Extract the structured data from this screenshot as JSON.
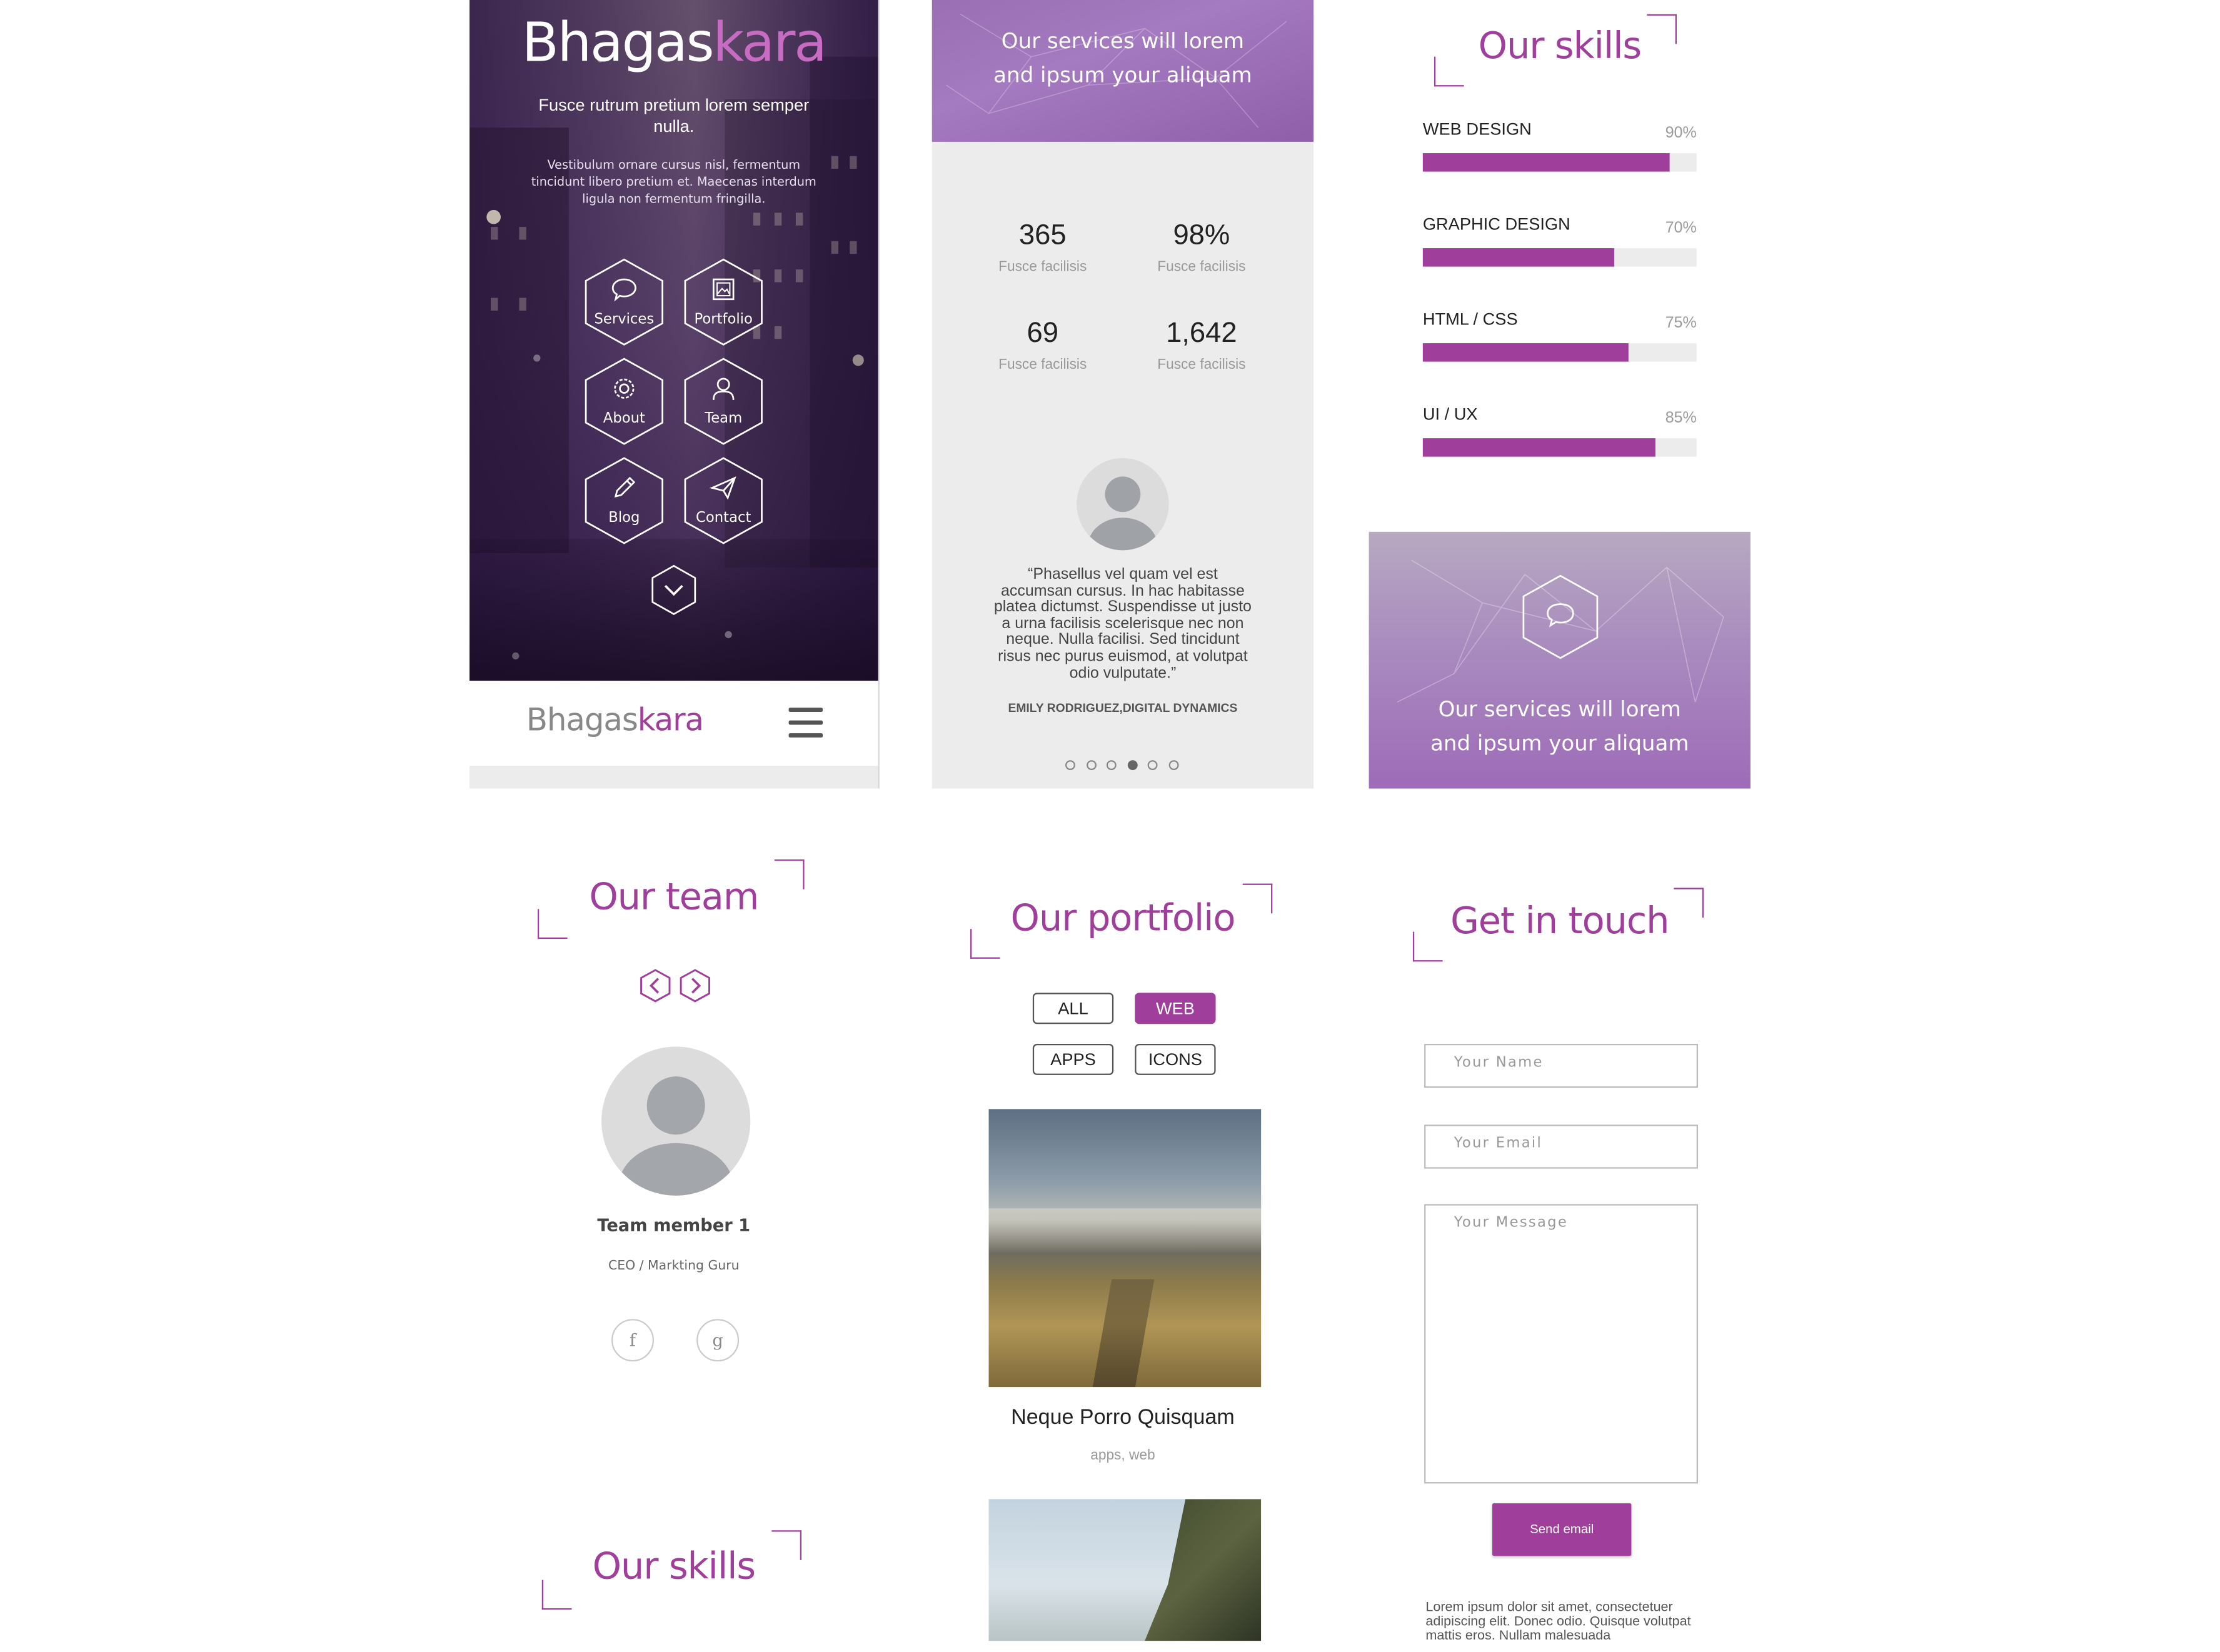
{
  "colors": {
    "accent": "#a03f9b",
    "dark_bg": "#3a2a4a",
    "light_bg": "#ececec"
  },
  "hero": {
    "brand_part1": "Bhagas",
    "brand_part2": "kara",
    "tagline": "Fusce rutrum pretium lorem semper nulla.",
    "description": "Vestibulum ornare cursus nisl, fermentum tincidunt libero pretium et. Maecenas interdum ligula non fermentum fringilla.",
    "menu": [
      {
        "label": "Services",
        "icon": "speech-bubble-icon"
      },
      {
        "label": "Portfolio",
        "icon": "image-icon"
      },
      {
        "label": "About",
        "icon": "gear-icon"
      },
      {
        "label": "Team",
        "icon": "person-icon"
      },
      {
        "label": "Blog",
        "icon": "pencil-icon"
      },
      {
        "label": "Contact",
        "icon": "paper-plane-icon"
      }
    ],
    "scroll_icon": "chevron-down-icon"
  },
  "navbar": {
    "brand_part1": "Bhagas",
    "brand_part2": "kara",
    "menu_icon": "hamburger-icon"
  },
  "services_header": {
    "line1": "Our services will lorem",
    "line2": "and ipsum your aliquam"
  },
  "stats": [
    {
      "value": "365",
      "label": "Fusce facilisis"
    },
    {
      "value": "98%",
      "label": "Fusce facilisis"
    },
    {
      "value": "69",
      "label": "Fusce facilisis"
    },
    {
      "value": "1,642",
      "label": "Fusce facilisis"
    }
  ],
  "testimonial": {
    "quote": "“Phasellus vel quam vel est accumsan cursus. In hac habitasse platea dictumst. Suspendisse ut justo a urna facilisis scelerisque nec non neque. Nulla facilisi. Sed tincidunt risus nec purus euismod, at volutpat odio vulputate.”",
    "author": "EMILY RODRIGUEZ,DIGITAL DYNAMICS",
    "active_dot": 3,
    "dot_count": 6
  },
  "skills_top": {
    "heading": "Our skills",
    "items": [
      {
        "name": "WEB DESIGN",
        "percent_label": "90%",
        "fill": 0.9
      },
      {
        "name": "GRAPHIC DESIGN",
        "percent_label": "70%",
        "fill": 0.7
      },
      {
        "name": "HTML / CSS",
        "percent_label": "75%",
        "fill": 0.75
      },
      {
        "name": "UI / UX",
        "percent_label": "85%",
        "fill": 0.85
      }
    ]
  },
  "services_box": {
    "line1": "Our services will lorem",
    "line2": "and ipsum your aliquam",
    "icon": "speech-bubble-icon"
  },
  "team": {
    "heading": "Our team",
    "member_name": "Team member 1",
    "member_role": "CEO / Markting Guru",
    "social": [
      "f",
      "g"
    ],
    "prev_icon": "chevron-left-icon",
    "next_icon": "chevron-right-icon"
  },
  "skills_bottom": {
    "heading": "Our skills"
  },
  "portfolio": {
    "heading": "Our portfolio",
    "filters": [
      {
        "label": "ALL",
        "active": false
      },
      {
        "label": "WEB",
        "active": true
      },
      {
        "label": "APPS",
        "active": false
      },
      {
        "label": "ICONS",
        "active": false
      }
    ],
    "item_title": "Neque Porro Quisquam",
    "item_tags": "apps, web"
  },
  "contact": {
    "heading": "Get in touch",
    "name_placeholder": "Your Name",
    "email_placeholder": "Your Email",
    "message_placeholder": "Your Message",
    "send_label": "Send email",
    "footer_text": "Lorem ipsum dolor sit amet, consectetuer adipiscing elit. Donec odio. Quisque volutpat mattis eros. Nullam malesuada"
  }
}
